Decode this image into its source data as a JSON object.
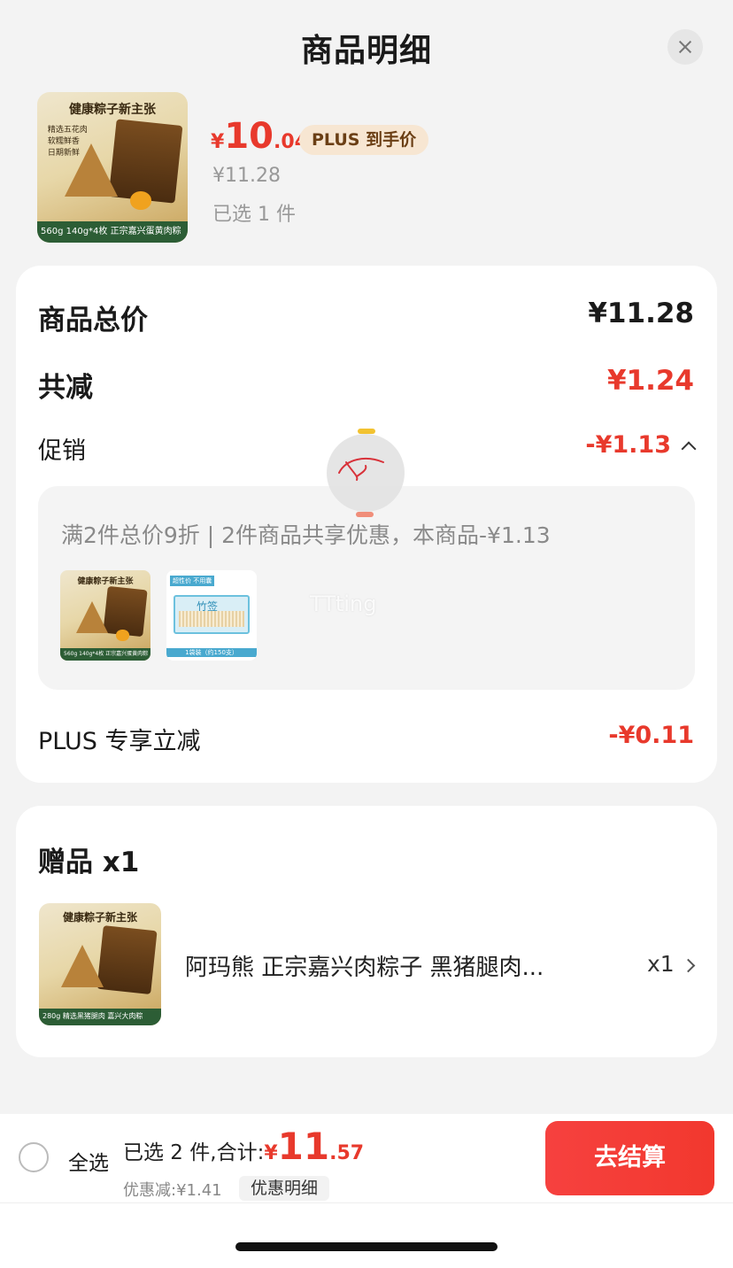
{
  "header": {
    "title": "商品明细"
  },
  "product": {
    "price_currency": "¥",
    "price_integer": "10",
    "price_decimal": ".04",
    "plus_tag": "PLUS 到手价",
    "original_price": "¥11.28",
    "selected": "已选 1 件",
    "thumb_title": "健康粽子新主张",
    "thumb_bullets": [
      "精选五花肉",
      "软糯鲜香",
      "日期新鲜"
    ],
    "thumb_bar": "560g 140g*4枚 正宗嘉兴蛋黄肉粽"
  },
  "summary": {
    "total_label": "商品总价",
    "total_value": "¥11.28",
    "discount_label": "共减",
    "discount_value": "¥1.24",
    "promo_label": "促销",
    "promo_value": "-¥1.13",
    "promo_detail": "满2件总价9折 | 2件商品共享优惠，本商品-¥1.13",
    "promo_item1_title": "健康粽子新主张",
    "promo_item1_bar": "560g 140g*4枚 正宗嘉兴蛋黄肉粽",
    "promo_item2_label": "超性价 不用囊",
    "promo_item2_box": "竹签",
    "promo_item2_foot": "1袋装（约150支）",
    "plus_label": "PLUS 专享立减",
    "plus_value": "-¥0.11"
  },
  "watermark": "TTting",
  "gift": {
    "heading": "赠品 x1",
    "thumb_title": "健康粽子新主张",
    "thumb_bar": "280g 精选黑猪腿肉 嘉兴大肉粽",
    "name": "阿玛熊 正宗嘉兴肉粽子 黑猪腿肉...",
    "qty": "x1"
  },
  "footer": {
    "select_all": "全选",
    "selected_total_label": "已选 2 件,合计:",
    "total_currency": "¥",
    "total_integer": "11",
    "total_decimal": ".57",
    "discount_text": "优惠减:¥1.41",
    "discount_detail_btn": "优惠明细",
    "checkout_btn": "去结算"
  }
}
